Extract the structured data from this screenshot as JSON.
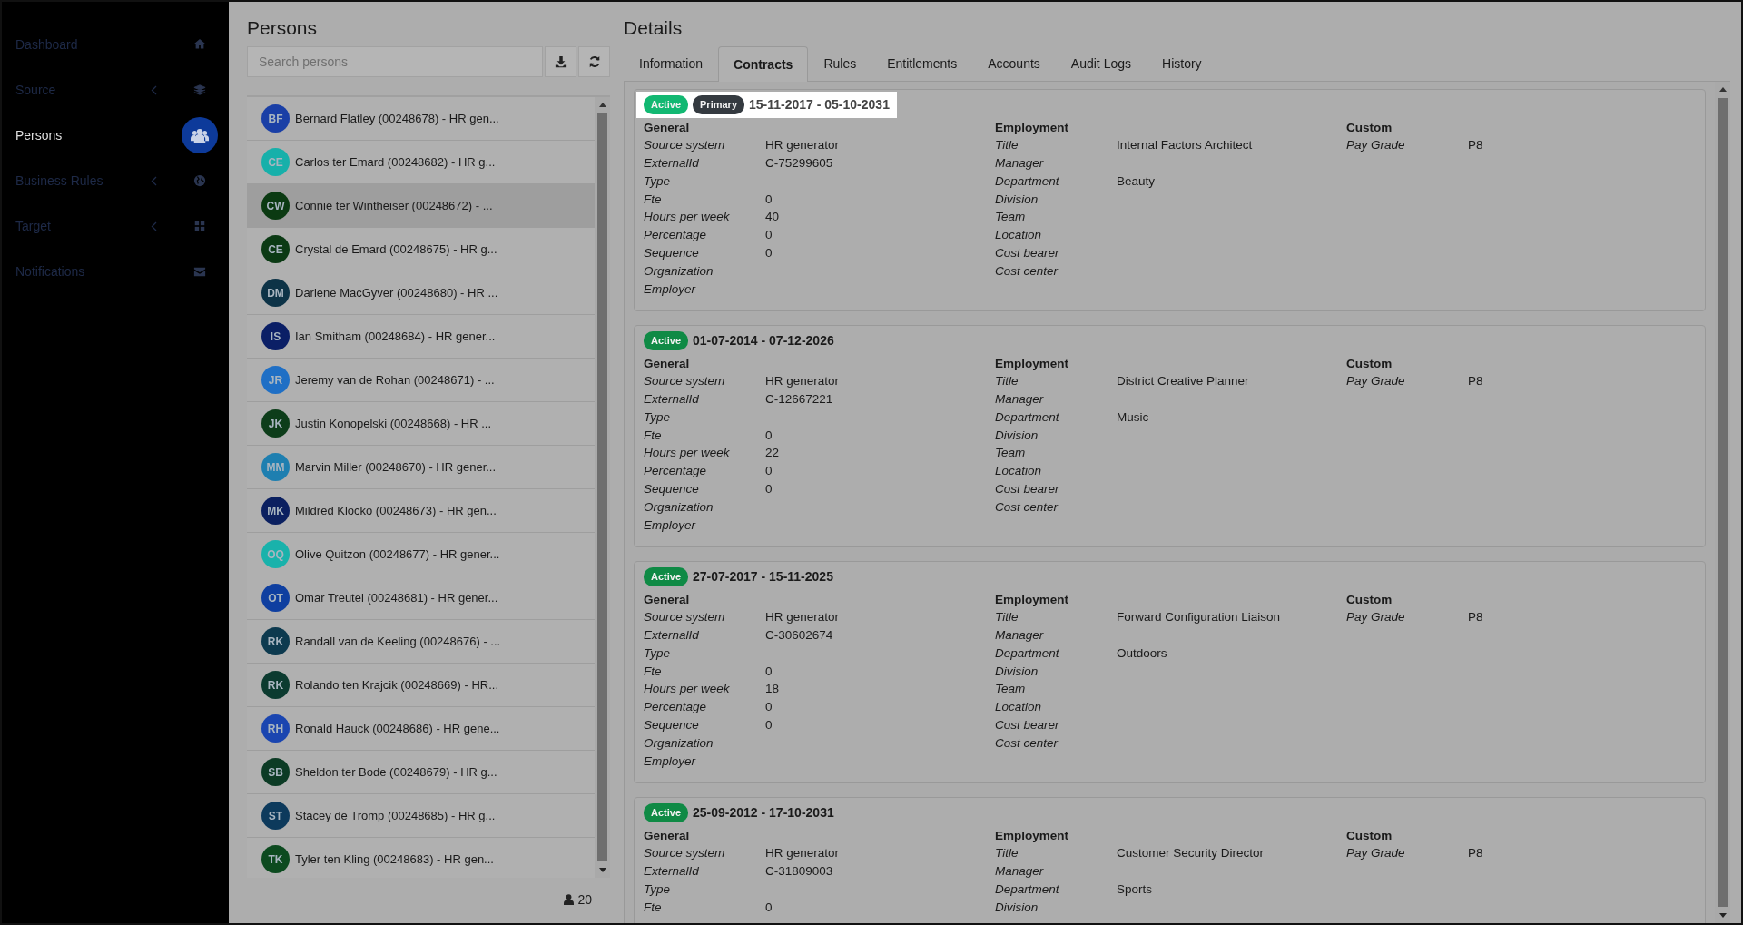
{
  "sidebar": {
    "items": [
      {
        "label": "Dashboard",
        "selected": false,
        "expandable": false
      },
      {
        "label": "Source",
        "selected": false,
        "expandable": true
      },
      {
        "label": "Persons",
        "selected": true,
        "expandable": false
      },
      {
        "label": "Business Rules",
        "selected": false,
        "expandable": true
      },
      {
        "label": "Target",
        "selected": false,
        "expandable": true
      },
      {
        "label": "Notifications",
        "selected": false,
        "expandable": false
      }
    ]
  },
  "persons": {
    "title": "Persons",
    "search": {
      "placeholder": "Search persons"
    },
    "list": [
      {
        "initials": "BF",
        "name": "Bernard Flatley (00248678) - HR gen...",
        "color": "#1a3fa6",
        "selected": false
      },
      {
        "initials": "CE",
        "name": "Carlos ter Emard (00248682) - HR g...",
        "color": "#17b0aa",
        "selected": false
      },
      {
        "initials": "CW",
        "name": "Connie ter Wintheiser (00248672) - ...",
        "color": "#0b3a12",
        "selected": true
      },
      {
        "initials": "CE",
        "name": "Crystal de Emard (00248675) - HR g...",
        "color": "#0b3a14",
        "selected": false
      },
      {
        "initials": "DM",
        "name": "Darlene MacGyver (00248680) - HR ...",
        "color": "#0d3347",
        "selected": false
      },
      {
        "initials": "IS",
        "name": "Ian Smitham (00248684) - HR gener...",
        "color": "#0b1f66",
        "selected": false
      },
      {
        "initials": "JR",
        "name": "Jeremy van de Rohan (00248671) - ...",
        "color": "#1f6fc5",
        "selected": false
      },
      {
        "initials": "JK",
        "name": "Justin Konopelski (00248668) - HR ...",
        "color": "#0d3d1a",
        "selected": false
      },
      {
        "initials": "MM",
        "name": "Marvin Miller (00248670) - HR gener...",
        "color": "#1e7fb0",
        "selected": false
      },
      {
        "initials": "MK",
        "name": "Mildred Klocko (00248673) - HR gen...",
        "color": "#0b2060",
        "selected": false
      },
      {
        "initials": "OQ",
        "name": "Olive Quitzon (00248677) - HR gener...",
        "color": "#19b2ab",
        "selected": false
      },
      {
        "initials": "OT",
        "name": "Omar Treutel (00248681) - HR gener...",
        "color": "#0f3fa0",
        "selected": false
      },
      {
        "initials": "RK",
        "name": "Randall van de Keeling (00248676) - ...",
        "color": "#0d3a4f",
        "selected": false
      },
      {
        "initials": "RK",
        "name": "Rolando ten Krajcik (00248669) - HR...",
        "color": "#0c3b30",
        "selected": false
      },
      {
        "initials": "RH",
        "name": "Ronald Hauck (00248686) - HR gene...",
        "color": "#1a45b0",
        "selected": false
      },
      {
        "initials": "SB",
        "name": "Sheldon ter Bode (00248679) - HR g...",
        "color": "#0c3b25",
        "selected": false
      },
      {
        "initials": "ST",
        "name": "Stacey de Tromp (00248685) - HR g...",
        "color": "#0d3a5c",
        "selected": false
      },
      {
        "initials": "TK",
        "name": "Tyler ten Kling (00248683) - HR gen...",
        "color": "#0c4a1f",
        "selected": false
      }
    ],
    "count": "20"
  },
  "details": {
    "title": "Details",
    "tabs": [
      {
        "label": "Information",
        "selected": false
      },
      {
        "label": "Contracts",
        "selected": true
      },
      {
        "label": "Rules",
        "selected": false
      },
      {
        "label": "Entitlements",
        "selected": false
      },
      {
        "label": "Accounts",
        "selected": false
      },
      {
        "label": "Audit Logs",
        "selected": false
      },
      {
        "label": "History",
        "selected": false
      }
    ],
    "contracts": [
      {
        "status": "Active",
        "primary": "Primary",
        "highlighted": true,
        "period": "15-11-2017 - 05-10-2031",
        "sections": [
          {
            "title": "General",
            "rows": [
              {
                "label": "Source system",
                "value": "HR generator"
              },
              {
                "label": "ExternalId",
                "value": "C-75299605"
              },
              {
                "label": "Type"
              },
              {
                "label": "Fte",
                "value": "0"
              },
              {
                "label": "Hours per week",
                "value": "40"
              },
              {
                "label": "Percentage",
                "value": "0"
              },
              {
                "label": "Sequence",
                "value": "0"
              },
              {
                "label": "Organization"
              },
              {
                "label": "Employer"
              }
            ]
          },
          {
            "title": "Employment",
            "rows": [
              {
                "label": "Title",
                "value": "Internal Factors Architect"
              },
              {
                "label": "Manager"
              },
              {
                "label": "Department",
                "value": "Beauty"
              },
              {
                "label": "Division"
              },
              {
                "label": "Team"
              },
              {
                "label": "Location"
              },
              {
                "label": "Cost bearer"
              },
              {
                "label": "Cost center"
              }
            ]
          },
          {
            "title": "Custom",
            "rows": [
              {
                "label": "Pay Grade",
                "value": "P8"
              }
            ]
          }
        ]
      },
      {
        "status": "Active",
        "highlighted": false,
        "period": "01-07-2014 - 07-12-2026",
        "sections": [
          {
            "title": "General",
            "rows": [
              {
                "label": "Source system",
                "value": "HR generator"
              },
              {
                "label": "ExternalId",
                "value": "C-12667221"
              },
              {
                "label": "Type"
              },
              {
                "label": "Fte",
                "value": "0"
              },
              {
                "label": "Hours per week",
                "value": "22"
              },
              {
                "label": "Percentage",
                "value": "0"
              },
              {
                "label": "Sequence",
                "value": "0"
              },
              {
                "label": "Organization"
              },
              {
                "label": "Employer"
              }
            ]
          },
          {
            "title": "Employment",
            "rows": [
              {
                "label": "Title",
                "value": "District Creative Planner"
              },
              {
                "label": "Manager"
              },
              {
                "label": "Department",
                "value": "Music"
              },
              {
                "label": "Division"
              },
              {
                "label": "Team"
              },
              {
                "label": "Location"
              },
              {
                "label": "Cost bearer"
              },
              {
                "label": "Cost center"
              }
            ]
          },
          {
            "title": "Custom",
            "rows": [
              {
                "label": "Pay Grade",
                "value": "P8"
              }
            ]
          }
        ]
      },
      {
        "status": "Active",
        "highlighted": false,
        "period": "27-07-2017 - 15-11-2025",
        "sections": [
          {
            "title": "General",
            "rows": [
              {
                "label": "Source system",
                "value": "HR generator"
              },
              {
                "label": "ExternalId",
                "value": "C-30602674"
              },
              {
                "label": "Type"
              },
              {
                "label": "Fte",
                "value": "0"
              },
              {
                "label": "Hours per week",
                "value": "18"
              },
              {
                "label": "Percentage",
                "value": "0"
              },
              {
                "label": "Sequence",
                "value": "0"
              },
              {
                "label": "Organization"
              },
              {
                "label": "Employer"
              }
            ]
          },
          {
            "title": "Employment",
            "rows": [
              {
                "label": "Title",
                "value": "Forward Configuration Liaison"
              },
              {
                "label": "Manager"
              },
              {
                "label": "Department",
                "value": "Outdoors"
              },
              {
                "label": "Division"
              },
              {
                "label": "Team"
              },
              {
                "label": "Location"
              },
              {
                "label": "Cost bearer"
              },
              {
                "label": "Cost center"
              }
            ]
          },
          {
            "title": "Custom",
            "rows": [
              {
                "label": "Pay Grade",
                "value": "P8"
              }
            ]
          }
        ]
      },
      {
        "status": "Active",
        "highlighted": false,
        "period": "25-09-2012 - 17-10-2031",
        "sections": [
          {
            "title": "General",
            "rows": [
              {
                "label": "Source system",
                "value": "HR generator"
              },
              {
                "label": "ExternalId",
                "value": "C-31809003"
              },
              {
                "label": "Type"
              },
              {
                "label": "Fte",
                "value": "0"
              }
            ]
          },
          {
            "title": "Employment",
            "rows": [
              {
                "label": "Title",
                "value": "Customer Security Director"
              },
              {
                "label": "Manager"
              },
              {
                "label": "Department",
                "value": "Sports"
              },
              {
                "label": "Division"
              }
            ]
          },
          {
            "title": "Custom",
            "rows": [
              {
                "label": "Pay Grade",
                "value": "P8"
              }
            ]
          }
        ]
      }
    ]
  }
}
